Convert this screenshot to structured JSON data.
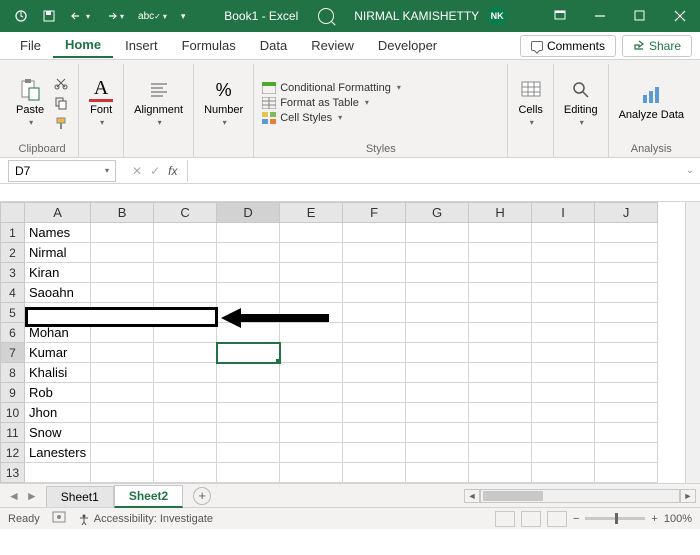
{
  "titlebar": {
    "doc_title": "Book1 - Excel",
    "user_name": "NIRMAL KAMISHETTY",
    "user_initials": "NK"
  },
  "tabs": {
    "file": "File",
    "home": "Home",
    "insert": "Insert",
    "formulas": "Formulas",
    "data": "Data",
    "review": "Review",
    "developer": "Developer",
    "comments": "Comments",
    "share": "Share"
  },
  "ribbon": {
    "clipboard": {
      "paste": "Paste",
      "label": "Clipboard"
    },
    "font": {
      "btn": "Font"
    },
    "alignment": {
      "btn": "Alignment"
    },
    "number": {
      "btn": "Number"
    },
    "styles": {
      "cond_format": "Conditional Formatting",
      "format_table": "Format as Table",
      "cell_styles": "Cell Styles",
      "label": "Styles"
    },
    "cells": {
      "btn": "Cells"
    },
    "editing": {
      "btn": "Editing"
    },
    "analysis": {
      "btn": "Analyze Data",
      "label": "Analysis"
    }
  },
  "formula_bar": {
    "name_box": "D7",
    "fx_label": "fx",
    "formula": ""
  },
  "columns": [
    "A",
    "B",
    "C",
    "D",
    "E",
    "F",
    "G",
    "H",
    "I",
    "J"
  ],
  "rows": [
    "1",
    "2",
    "3",
    "4",
    "5",
    "6",
    "7",
    "8",
    "9",
    "10",
    "11",
    "12",
    "13"
  ],
  "cells": {
    "A1": "Names",
    "A2": "Nirmal",
    "A3": "Kiran",
    "A4": "Saoahn",
    "A5": "",
    "A6": "Mohan",
    "A7": "Kumar",
    "A8": "Khalisi",
    "A9": "Rob",
    "A10": "Jhon",
    "A11": "Snow",
    "A12": "Lanesters"
  },
  "selected_cell": "D7",
  "sheet_tabs": {
    "sheet1": "Sheet1",
    "sheet2": "Sheet2"
  },
  "statusbar": {
    "ready": "Ready",
    "accessibility": "Accessibility: Investigate",
    "zoom": "100%"
  }
}
